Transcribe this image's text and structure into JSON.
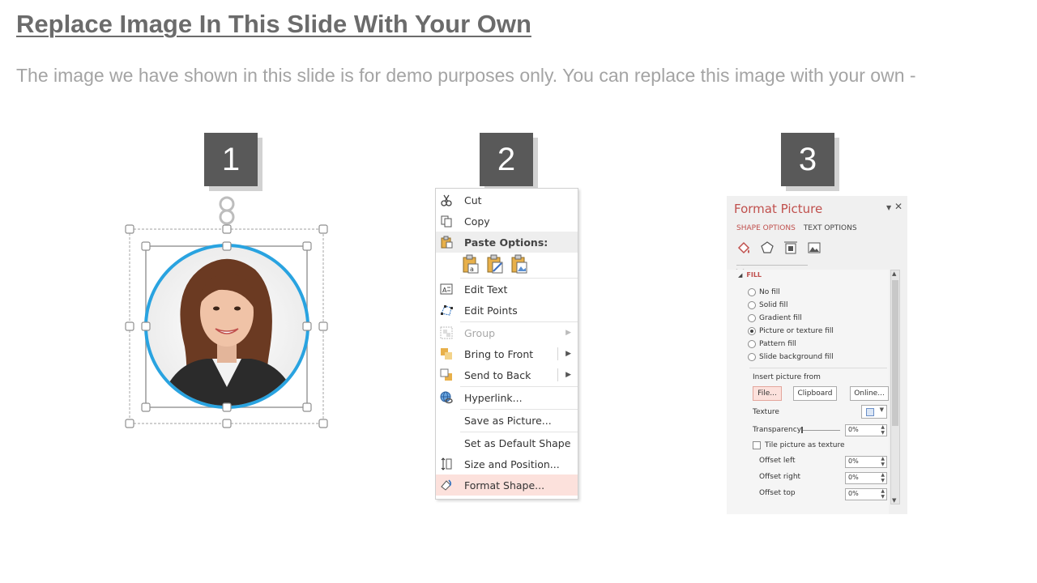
{
  "slide": {
    "title": "Replace Image In This Slide With Your Own",
    "subtitle": "The image we have shown in this slide is for demo purposes only. You can replace this image with your own -"
  },
  "steps": [
    "1",
    "2",
    "3"
  ],
  "context_menu": {
    "cut": "Cut",
    "copy": "Copy",
    "paste_options": "Paste Options:",
    "edit_text": "Edit Text",
    "edit_points": "Edit Points",
    "group": "Group",
    "bring_to_front": "Bring to Front",
    "send_to_back": "Send to Back",
    "hyperlink": "Hyperlink...",
    "save_as_picture": "Save as Picture...",
    "set_default_shape": "Set as Default Shape",
    "size_and_position": "Size and Position...",
    "format_shape": "Format Shape..."
  },
  "format_panel": {
    "title": "Format Picture",
    "tab_shape": "SHAPE OPTIONS",
    "tab_text": "TEXT OPTIONS",
    "fill_heading": "FILL",
    "fill_options": [
      "No fill",
      "Solid fill",
      "Gradient fill",
      "Picture or texture fill",
      "Pattern fill",
      "Slide background fill"
    ],
    "selected_fill": "Picture or texture fill",
    "insert_from": "Insert picture from",
    "file_btn": "File...",
    "clipboard_btn": "Clipboard",
    "online_btn": "Online...",
    "texture_label": "Texture",
    "transparency_label": "Transparency",
    "transparency_value": "0%",
    "tile_label": "Tile picture as texture",
    "offset_left_label": "Offset left",
    "offset_left_value": "0%",
    "offset_right_label": "Offset right",
    "offset_right_value": "0%",
    "offset_top_label": "Offset top",
    "offset_top_value": "0%"
  },
  "colors": {
    "step_box": "#595959",
    "accent_ring": "#29a3e0",
    "panel_accent": "#c0504d",
    "menu_highlight": "#fce1dc"
  }
}
